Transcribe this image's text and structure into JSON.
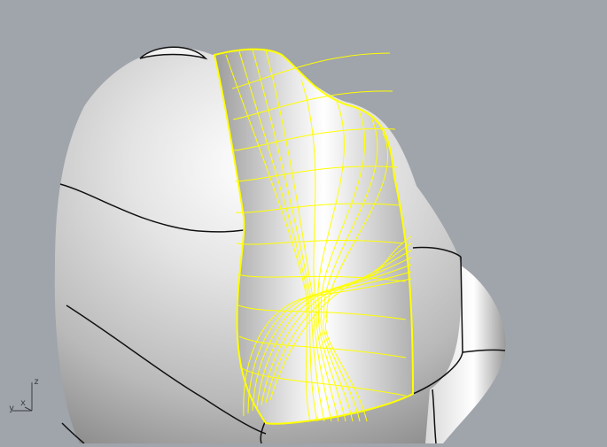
{
  "viewport": {
    "background": "#a0a4ab",
    "highlight_color": "#ffff00",
    "edge_color": "#111111"
  },
  "axis_widget": {
    "z_label": "z",
    "y_label": "y",
    "x_label": "x"
  }
}
